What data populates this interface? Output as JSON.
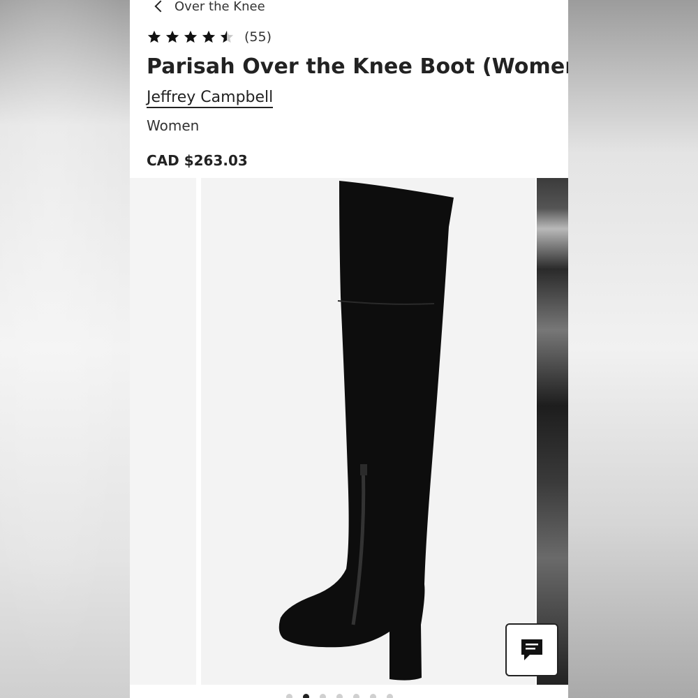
{
  "breadcrumb": {
    "label": "Over the Knee"
  },
  "product": {
    "rating": 4.5,
    "rating_count": "(55)",
    "title": "Parisah Over the Knee Boot (Women)",
    "brand": "Jeffrey Campbell",
    "category": "Women",
    "price": "CAD $263.03"
  },
  "gallery": {
    "image_count": 7,
    "active_index": 1
  },
  "icons": {
    "back": "chevron-left-icon",
    "star": "star-icon",
    "chat": "chat-bubble-icon"
  },
  "colors": {
    "text": "#222222",
    "star": "#111111",
    "star_empty": "#c9c9c9"
  }
}
